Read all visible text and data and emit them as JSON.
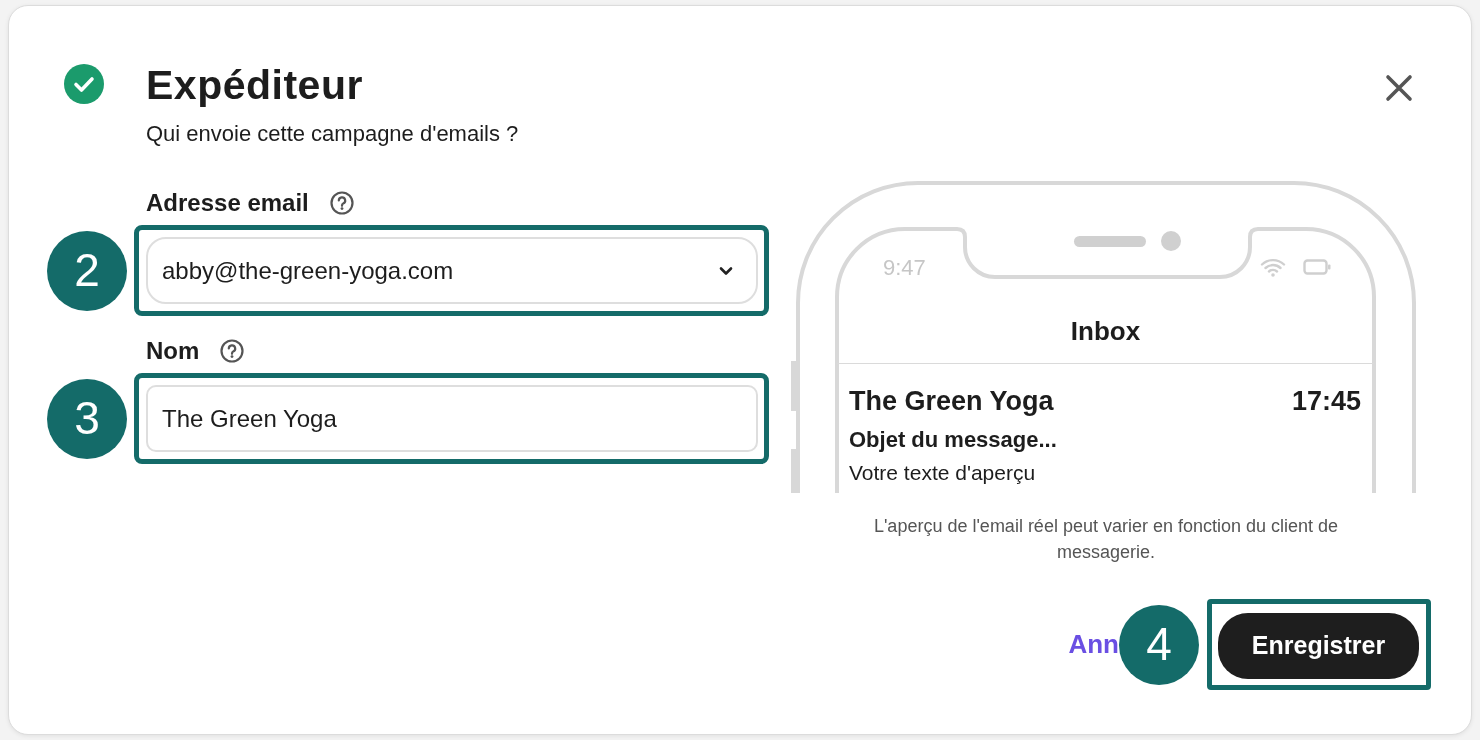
{
  "dialog": {
    "completed": true,
    "title": "Expéditeur",
    "subtitle": "Qui envoie cette campagne d'emails ?"
  },
  "fields": [
    {
      "kind": "select",
      "label": "Adresse email",
      "help": true,
      "value": "abby@the-green-yoga.com",
      "callout": "2"
    },
    {
      "kind": "text",
      "label": "Nom",
      "help": true,
      "value": "The Green Yoga",
      "callout": "3"
    }
  ],
  "preview": {
    "status_time": "9:47",
    "header": "Inbox",
    "message": {
      "sender": "The Green Yoga",
      "time": "17:45",
      "subject": "Objet du message...",
      "snippet": "Votre texte d'aperçu"
    },
    "caption": "L'aperçu de l'email réel peut varier en fonction du client de messagerie."
  },
  "actions": [
    {
      "kind": "link",
      "label": "Ann"
    },
    {
      "kind": "primary",
      "label": "Enregistrer",
      "callout": "4"
    }
  ]
}
